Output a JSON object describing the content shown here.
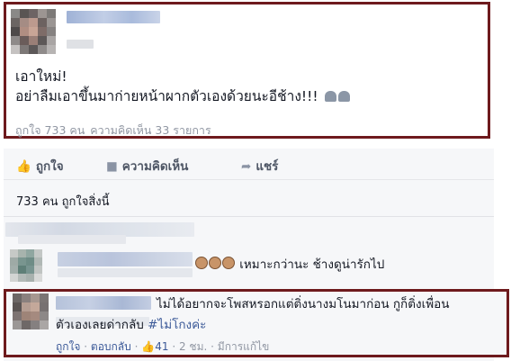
{
  "post": {
    "text_line1": "เอาใหม่!",
    "text_line2": "อย่าลืมเอาขึ้นมาก่ายหน้าผากตัวเองด้วยนะอีช้าง!!!",
    "likes_text": "ถูกใจ 733 คน",
    "comments_text": "ความคิดเห็น 33 รายการ"
  },
  "actions": {
    "like": "ถูกใจ",
    "comment": "ความคิดเห็น",
    "share": "แชร์"
  },
  "likes_summary": "733 คน ถูกใจสิ่งนี้",
  "comment_2": {
    "text": "เหมาะกว่านะ ช้างดูน่ารักไป"
  },
  "highlighted_comment": {
    "line1": "ไม่ได้อยากจะโพสหรอกแต่ติ่งนางมโนมาก่อน กูก็ติ่งเพื่อน",
    "line2_prefix": "ตัวเองเลยด่ากลับ",
    "hashtag": "#ไม่โกงค่ะ",
    "like": "ถูกใจ",
    "reply": "ตอบกลับ",
    "like_count": "41",
    "time": "2 ชม.",
    "edited": "มีการแก้ไข"
  }
}
